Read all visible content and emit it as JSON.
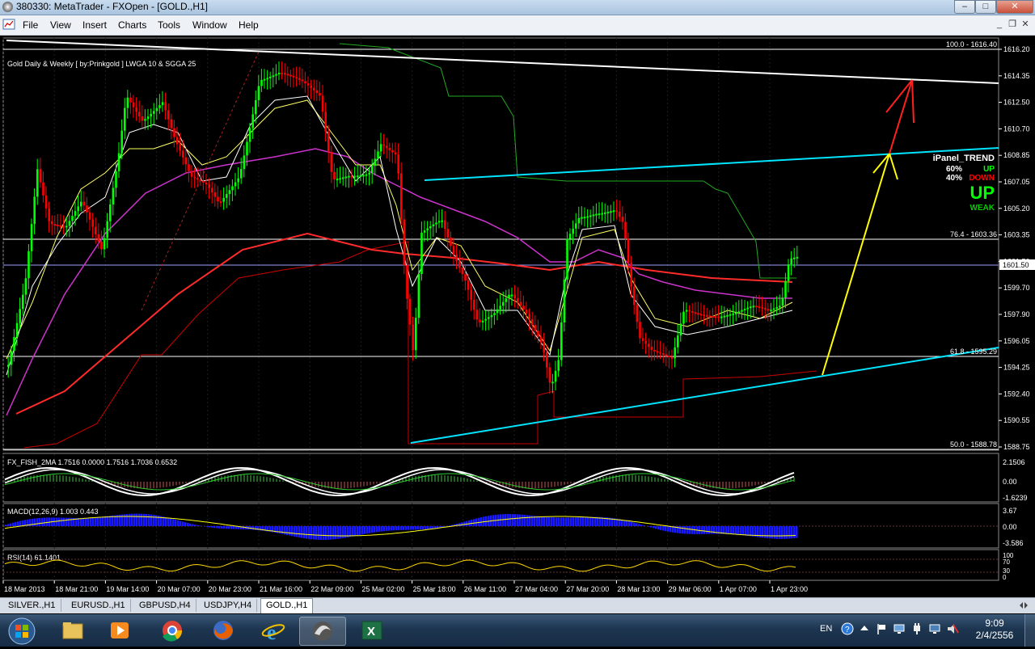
{
  "window": {
    "title": "380330: MetaTrader - FXOpen - [GOLD.,H1]"
  },
  "menu": [
    "File",
    "View",
    "Insert",
    "Charts",
    "Tools",
    "Window",
    "Help"
  ],
  "chart": {
    "indicator_label": "Gold Daily & Weekly [ by:Prinkgold ]  LWGA 10  &  SGGA 25",
    "price_axis": [
      "1616.20",
      "1614.35",
      "1612.50",
      "1610.70",
      "1608.85",
      "1607.05",
      "1605.20",
      "1603.35",
      "1601.50",
      "1599.70",
      "1597.90",
      "1596.05",
      "1594.25",
      "1592.40",
      "1590.55",
      "1588.75"
    ],
    "current_price": "1601.50",
    "fib_labels": {
      "top": "100.0 - 1616.40",
      "f764": "76.4 - 1603.36",
      "f618": "61.8 - 1595.29",
      "f50": "50.0 - 1588.78"
    },
    "time_axis": [
      "18 Mar 2013",
      "18 Mar 21:00",
      "19 Mar 14:00",
      "20 Mar 07:00",
      "20 Mar 23:00",
      "21 Mar 16:00",
      "22 Mar 09:00",
      "25 Mar 02:00",
      "25 Mar 18:00",
      "26 Mar 11:00",
      "27 Mar 04:00",
      "27 Mar 20:00",
      "28 Mar 13:00",
      "29 Mar 06:00",
      "1 Apr 07:00",
      "1 Apr 23:00"
    ],
    "panel": {
      "title": "iPanel_TREND",
      "up_pct": "60%",
      "up_label": "UP",
      "down_pct": "40%",
      "down_label": "DOWN",
      "big": "UP",
      "strength": "WEAK"
    },
    "fisher": {
      "label": "FX_FISH_2MA 1.7516 0.0000 1.7516 1.7036 0.6532",
      "axis": [
        "2.1506",
        "0.00",
        "-1.6239"
      ]
    },
    "macd": {
      "label": "MACD(12,26,9) 1.003 0.443",
      "axis": [
        "3.67",
        "0.00",
        "-3.586"
      ]
    },
    "rsi": {
      "label": "RSI(14) 61.1401",
      "axis": [
        "100",
        "70",
        "30",
        "0"
      ]
    },
    "colors": {
      "bull": "#00ff00",
      "bear": "#ff0000",
      "trend": "#00e5ff",
      "resistance": "#ffffff",
      "arrow_up": "#ffff00",
      "arrow_target": "#ff2020"
    }
  },
  "tabs": [
    "SILVER.,H1",
    "EURUSD.,H1",
    "GBPUSD,H4",
    "USDJPY,H4",
    "GOLD.,H1"
  ],
  "taskbar": {
    "lang": "EN",
    "time": "9:09",
    "date": "2/4/2556"
  }
}
